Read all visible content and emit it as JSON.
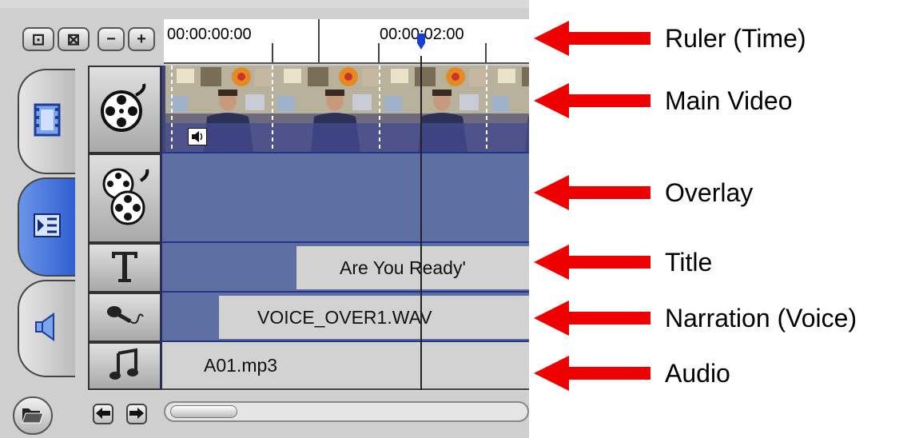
{
  "toolbar": {
    "buttons": [
      "⊡",
      "⊠",
      "−",
      "+"
    ]
  },
  "ruler": {
    "start_time": "00:00:00:00",
    "mid_time": "00:00:02:00"
  },
  "tracks": {
    "title_clip": "Are  You  Ready'",
    "narration_clip": "VOICE_OVER1.WAV",
    "audio_clip": "A01.mp3"
  },
  "annotations": {
    "ruler": "Ruler (Time)",
    "main_video": "Main Video",
    "overlay": "Overlay",
    "title": "Title",
    "narration": "Narration (Voice)",
    "audio": "Audio"
  },
  "colors": {
    "track_blue": "#5d6ea3",
    "clip_gray": "#d2d2d2",
    "arrow_red": "#ee0000",
    "tab_active": "#3b6ad8"
  }
}
